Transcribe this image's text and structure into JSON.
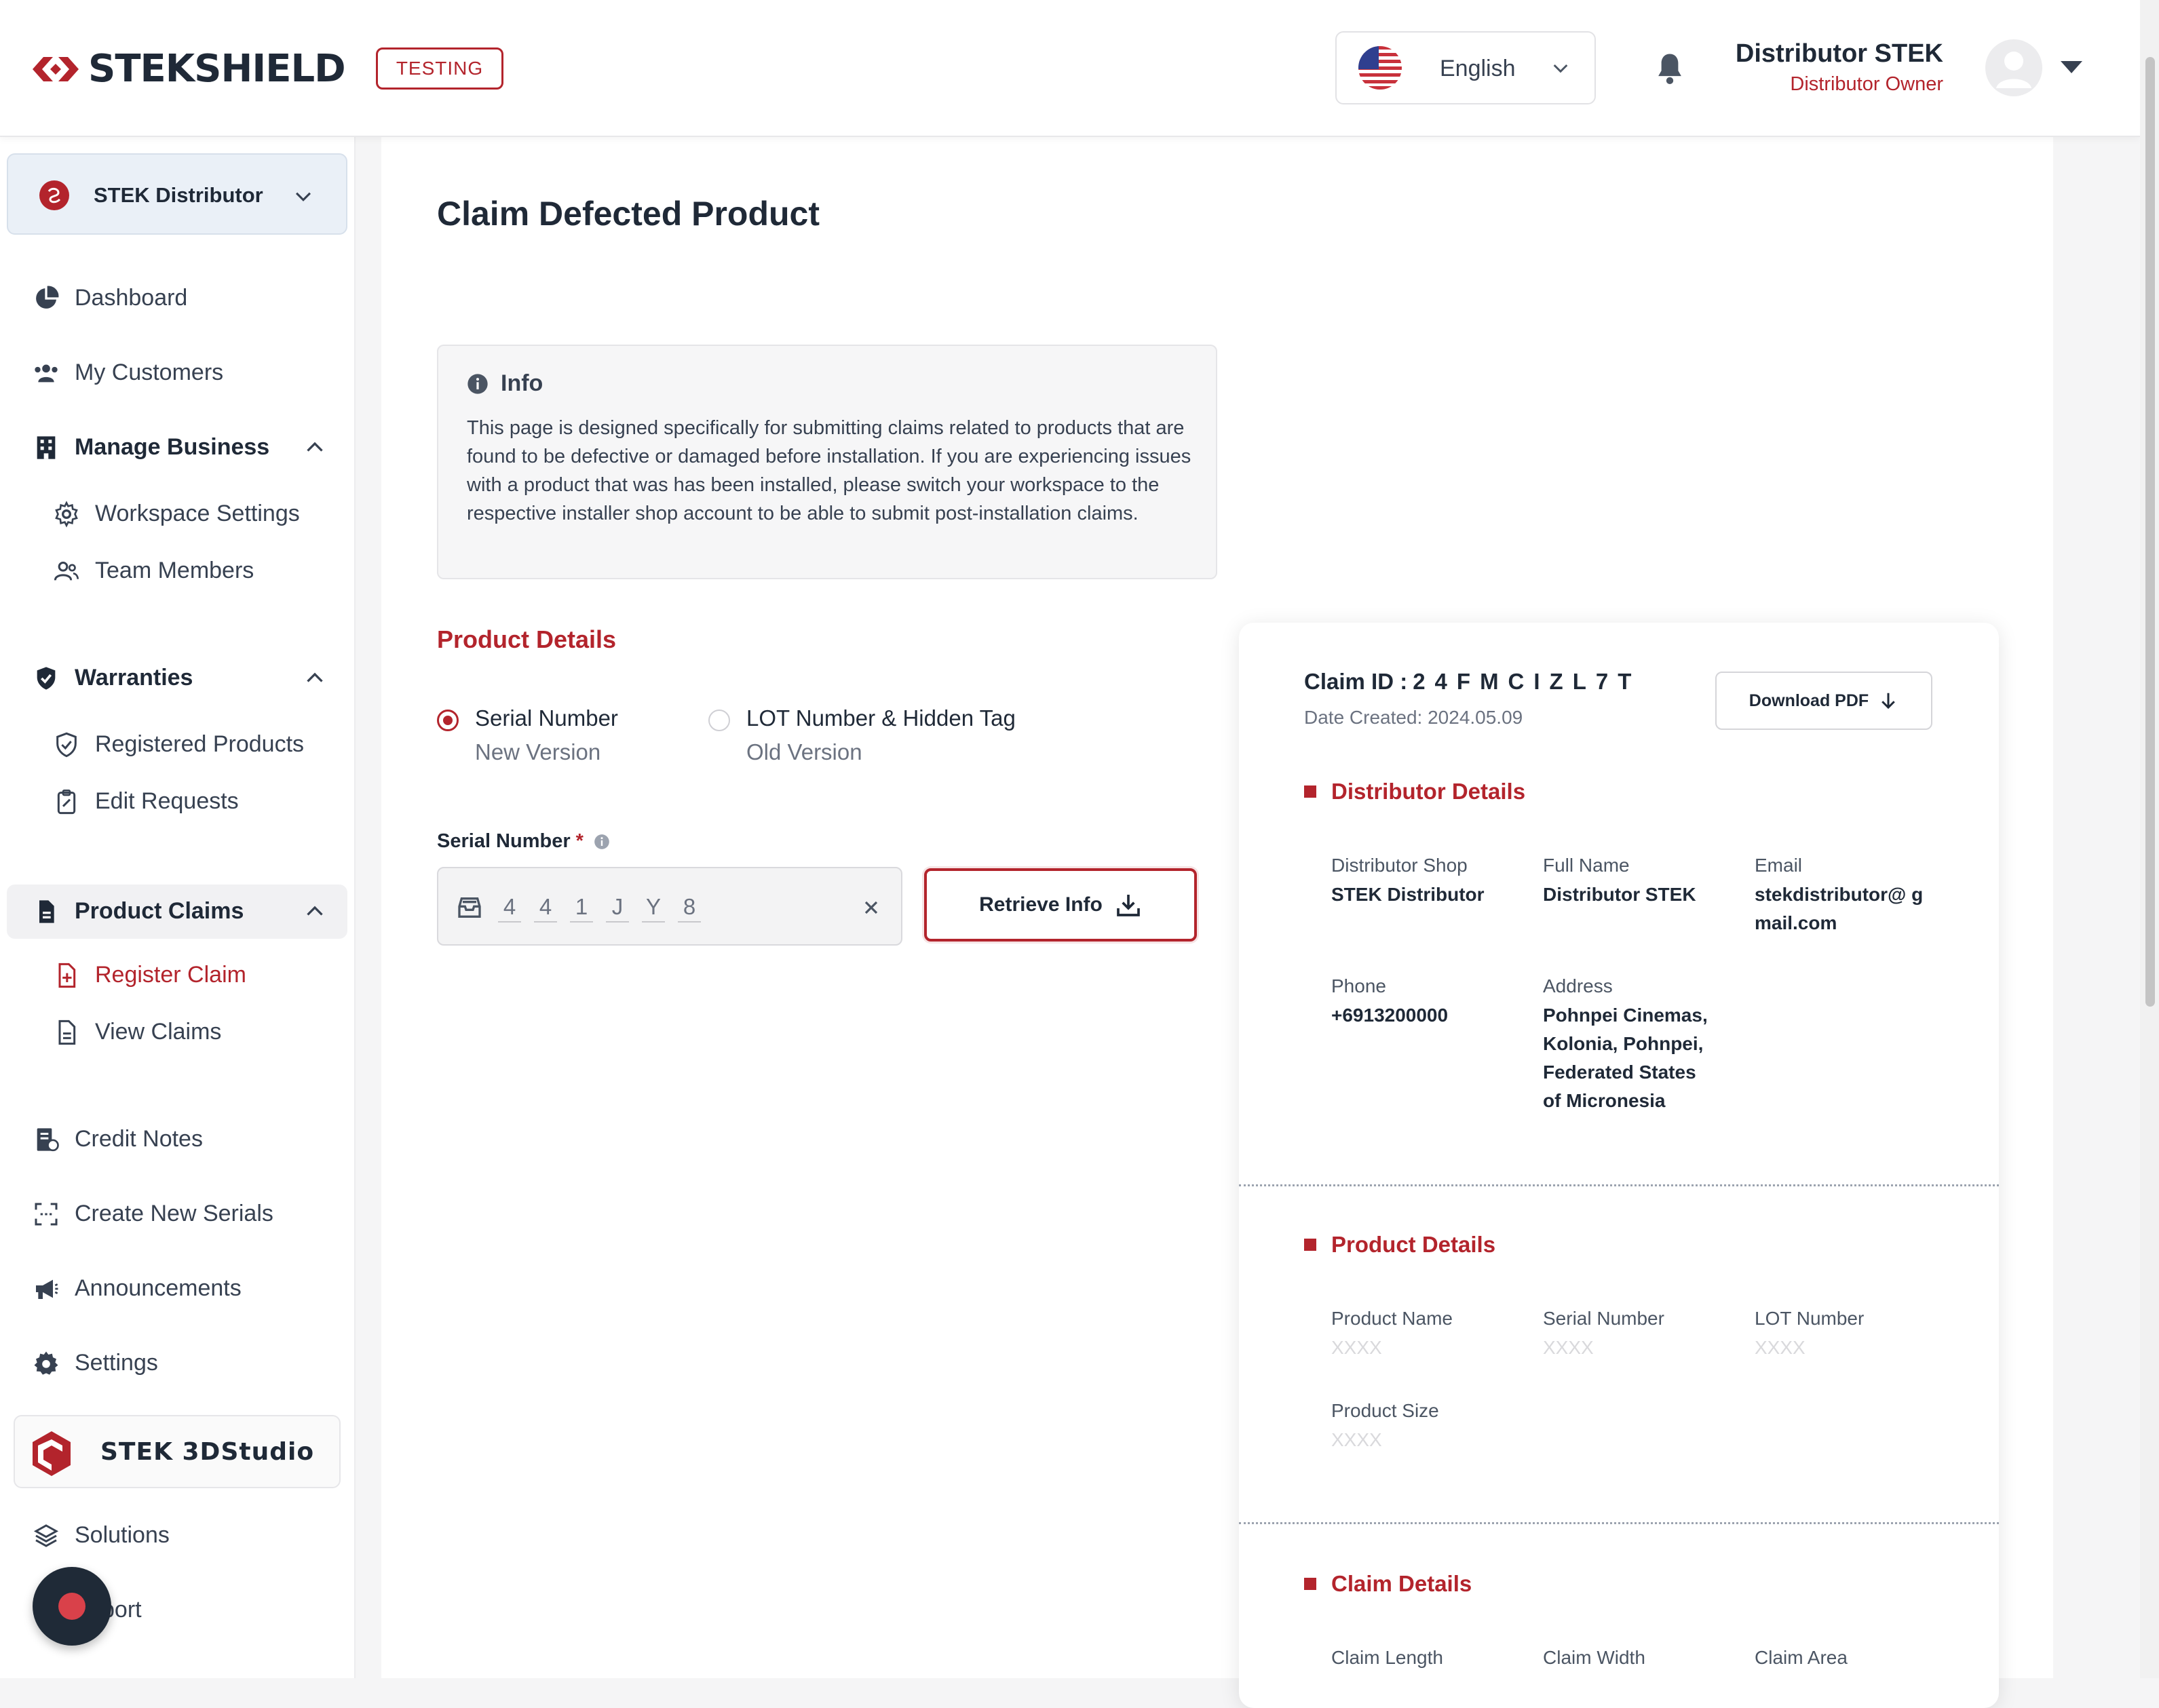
{
  "header": {
    "brand": "STEKSHIELD",
    "environment_badge": "TESTING",
    "language": "English",
    "user": {
      "name": "Distributor STEK",
      "role": "Distributor Owner"
    }
  },
  "sidebar": {
    "workspace": "STEK Distributor",
    "items": {
      "dashboard": "Dashboard",
      "my_customers": "My Customers",
      "manage_business": "Manage Business",
      "workspace_settings": "Workspace Settings",
      "team_members": "Team Members",
      "warranties": "Warranties",
      "registered_products": "Registered Products",
      "edit_requests": "Edit Requests",
      "product_claims": "Product Claims",
      "register_claim": "Register Claim",
      "view_claims": "View Claims",
      "credit_notes": "Credit Notes",
      "create_new_serials": "Create New Serials",
      "announcements": "Announcements",
      "settings": "Settings",
      "studio": "STEK 3DStudio",
      "solutions": "Solutions",
      "support": "port"
    }
  },
  "main": {
    "title": "Claim Defected Product",
    "info": {
      "title": "Info",
      "text": "This page is designed specifically for submitting claims related to products that are found to be defective or damaged before installation. If you are experiencing issues with a product that was has been installed, please switch your workspace to the respective installer shop account to be able to submit post-installation claims."
    },
    "product_details_title": "Product Details",
    "options": [
      {
        "title": "Serial Number",
        "subtitle": "New Version",
        "selected": true
      },
      {
        "title": "LOT Number & Hidden Tag",
        "subtitle": "Old Version",
        "selected": false
      }
    ],
    "serial_label": "Serial Number",
    "required_mark": "*",
    "serial_chars": [
      "4",
      "4",
      "1",
      "J",
      "Y",
      "8"
    ],
    "retrieve_label": "Retrieve Info"
  },
  "card": {
    "claim_id_label": "Claim ID :",
    "claim_id": "24FMCIZL7T",
    "date_created": "Date Created: 2024.05.09",
    "download_label": "Download PDF",
    "distributor": {
      "title": "Distributor Details",
      "shop_label": "Distributor Shop",
      "shop": "STEK Distributor",
      "name_label": "Full Name",
      "name": "Distributor STEK",
      "email_label": "Email",
      "email": "stekdistributor@ gmail.com",
      "phone_label": "Phone",
      "phone": "+6913200000",
      "address_label": "Address",
      "address": "Pohnpei Cinemas, Kolonia, Pohnpei, Federated States of Micronesia"
    },
    "product": {
      "title": "Product Details",
      "name_label": "Product Name",
      "name": "XXXX",
      "serial_label": "Serial Number",
      "serial": "XXXX",
      "lot_label": "LOT Number",
      "lot": "XXXX",
      "size_label": "Product Size",
      "size": "XXXX"
    },
    "claim": {
      "title": "Claim Details",
      "length_label": "Claim Length",
      "width_label": "Claim Width",
      "area_label": "Claim Area"
    }
  },
  "colors": {
    "accent": "#b3242c",
    "text": "#1f2937",
    "muted": "#6b7280"
  }
}
